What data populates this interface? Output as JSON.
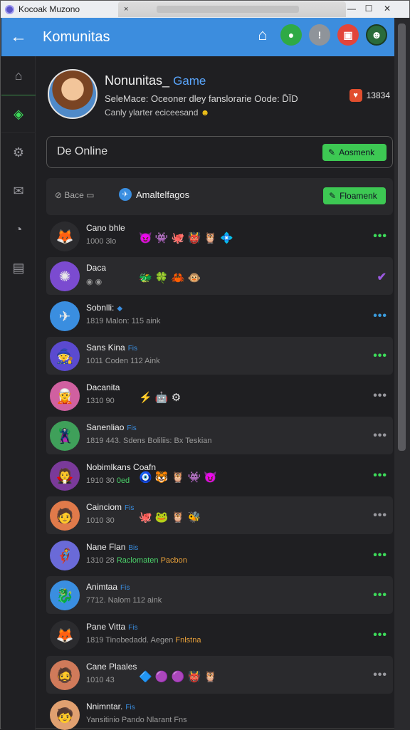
{
  "window": {
    "title": "Kocoak Muzono",
    "close": "×"
  },
  "appbar": {
    "title": "Komunitas",
    "back_icon": "arrow-left-icon"
  },
  "profile": {
    "name": "Nonunitas_",
    "tag": "Game",
    "description": "SeleMace: Oceoner dley fanslorarie Oode: D̈ÏD",
    "subtext": "Canly ylarter eciceesand",
    "count": "13834"
  },
  "status": {
    "text": "De Online",
    "button": "Aosmenk"
  },
  "filter": {
    "left_label": "Bace",
    "chip_label": "Amaltelfagos",
    "button": "Floamenk"
  },
  "rows": [
    {
      "name": "Cano bhle",
      "badge": "",
      "meta": "1000   3lo",
      "meta_hl": "",
      "icons": "😈 👾 🐙 👹 🦉 💠",
      "dots": "•••",
      "dots_color": "#3ddc5a",
      "avatar": "🦊",
      "avatar_bg": "#2b2b2e"
    },
    {
      "name": "Daca",
      "badge": "",
      "meta": "◉ ◉",
      "meta_hl": "",
      "icons": "🐲 🍀 🦀 🐵",
      "dots": "✔",
      "dots_color": "#9b59e0",
      "avatar": "✺",
      "avatar_bg": "#7b4bd0"
    },
    {
      "name": "Sobnlli:",
      "badge": "◆",
      "meta": "1819   Malon: 115 aink",
      "meta_hl": "",
      "icons": "",
      "dots": "•••",
      "dots_color": "#3a9bdc",
      "avatar": "✈",
      "avatar_bg": "#3a8ee0"
    },
    {
      "name": "Sans Kina",
      "badge": "Fis",
      "meta": "1011   Coden 112 Aink",
      "meta_hl": "",
      "icons": "",
      "dots": "•••",
      "dots_color": "#3ddc5a",
      "avatar": "🧙",
      "avatar_bg": "#5b4ad0"
    },
    {
      "name": "Dacanita",
      "badge": "",
      "meta": "1310   90",
      "meta_hl": "",
      "icons": "⚡ 🤖 ⚙",
      "dots": "•••",
      "dots_color": "#9a9aa0",
      "avatar": "🧝",
      "avatar_bg": "#d060a0"
    },
    {
      "name": "Sanenliao",
      "badge": "Fis",
      "meta": "1819   443. Sdens Boliliis: Bx Teskian",
      "meta_hl": "",
      "icons": "",
      "dots": "•••",
      "dots_color": "#9a9aa0",
      "avatar": "🦹",
      "avatar_bg": "#3fa05a"
    },
    {
      "name": "Nobimlkans Coafn",
      "badge": "",
      "meta": "1910   30",
      "meta_hl": "0ed",
      "icons": "🧿 🐯 🦉 👾 😈",
      "dots": "•••",
      "dots_color": "#3ddc5a",
      "avatar": "🧛",
      "avatar_bg": "#7a3a9a"
    },
    {
      "name": "Cainciom",
      "badge": "Fis",
      "meta": "1010   30",
      "meta_hl": "",
      "icons": "🐙 🐸 🦉 🐝",
      "dots": "•••",
      "dots_color": "#9a9aa0",
      "avatar": "🧑",
      "avatar_bg": "#e07a4a"
    },
    {
      "name": "Nane Flan",
      "badge": "Bis",
      "meta": "1310   28",
      "meta_hl": "Raclomaten",
      "meta_hl2": "Pacbon",
      "icons": "",
      "dots": "•••",
      "dots_color": "#3ddc5a",
      "avatar": "🦸",
      "avatar_bg": "#6a6ad8"
    },
    {
      "name": "Animtaa",
      "badge": "Fis",
      "meta": "7712.   Nalom 112 aink",
      "meta_hl": "",
      "icons": "",
      "dots": "•••",
      "dots_color": "#3ddc5a",
      "avatar": "🐉",
      "avatar_bg": "#3a8ee0"
    },
    {
      "name": "Pane Vitta",
      "badge": "Fis",
      "meta": "1819   Tinobedadd. Aegen",
      "meta_hl": "",
      "meta_hl2": "Fnlstna",
      "icons": "",
      "dots": "•••",
      "dots_color": "#3ddc5a",
      "avatar": "🦊",
      "avatar_bg": "#2b2b2e"
    },
    {
      "name": "Cane Plaales",
      "badge": "",
      "meta": "1010   43",
      "meta_hl": "",
      "icons": "🔷 🟣 🟣 👹 🦉",
      "dots": "•••",
      "dots_color": "#9a9aa0",
      "avatar": "🧔",
      "avatar_bg": "#d07a5a"
    },
    {
      "name": "Nnimntar.",
      "badge": "Fis",
      "meta": "Yansitinio Pando Nlarant Fns",
      "meta_hl": "",
      "icons": "",
      "dots": "",
      "dots_color": "#9a9aa0",
      "avatar": "🧒",
      "avatar_bg": "#e0a070"
    }
  ]
}
